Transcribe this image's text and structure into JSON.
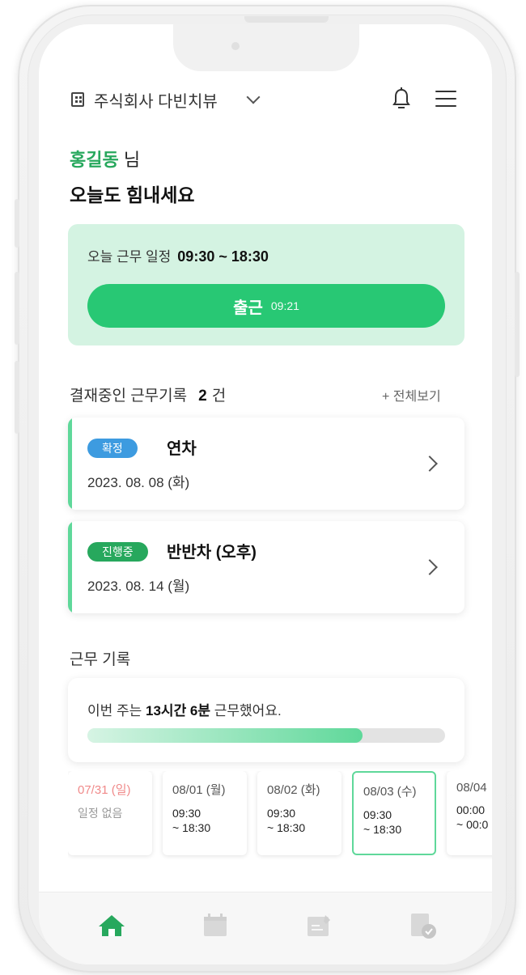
{
  "header": {
    "company": "주식회사 다빈치뷰",
    "icons": {
      "company": "building-icon",
      "dropdown": "chevron-down-icon",
      "notifications": "bell-icon",
      "menu": "hamburger-menu-icon"
    }
  },
  "greeting": {
    "name": "홍길동",
    "suffix": " 님",
    "message": "오늘도 힘내세요"
  },
  "today": {
    "label": "오늘 근무 일정",
    "time": "09:30 ~ 18:30",
    "checkin_label": "출근",
    "checkin_time": "09:21"
  },
  "pending": {
    "title": "결재중인 근무기록",
    "count": "2",
    "unit": "건",
    "view_all": "+ 전체보기",
    "items": [
      {
        "status": "확정",
        "status_color": "#3d9be0",
        "type": "연차",
        "date": "2023. 08. 08 (화)"
      },
      {
        "status": "진행중",
        "status_color": "#27a85d",
        "type": "반반차 (오후)",
        "date": "2023. 08. 14 (월)"
      }
    ]
  },
  "records": {
    "title": "근무 기록",
    "summary_prefix": "이번 주는 ",
    "summary_bold": "13시간 6분",
    "summary_suffix": " 근무했어요.",
    "progress": 0.77,
    "days": [
      {
        "date": "07/31 (일)",
        "time1": "일정 없음",
        "time2": "",
        "weekend": true,
        "selected": false
      },
      {
        "date": "08/01 (월)",
        "time1": "09:30",
        "time2": "~ 18:30",
        "weekend": false,
        "selected": false
      },
      {
        "date": "08/02 (화)",
        "time1": "09:30",
        "time2": "~ 18:30",
        "weekend": false,
        "selected": false
      },
      {
        "date": "08/03 (수)",
        "time1": "09:30",
        "time2": "~ 18:30",
        "weekend": false,
        "selected": true
      },
      {
        "date": "08/04",
        "time1": "00:00",
        "time2": "~ 00:0",
        "weekend": false,
        "selected": false
      }
    ]
  },
  "colors": {
    "accent": "#28c874",
    "accent_light": "#d4f3e2"
  },
  "tabs": [
    {
      "icon": "home-icon",
      "active": true
    },
    {
      "icon": "calendar-icon",
      "active": false
    },
    {
      "icon": "edit-note-icon",
      "active": false
    },
    {
      "icon": "approval-document-icon",
      "active": false
    }
  ]
}
